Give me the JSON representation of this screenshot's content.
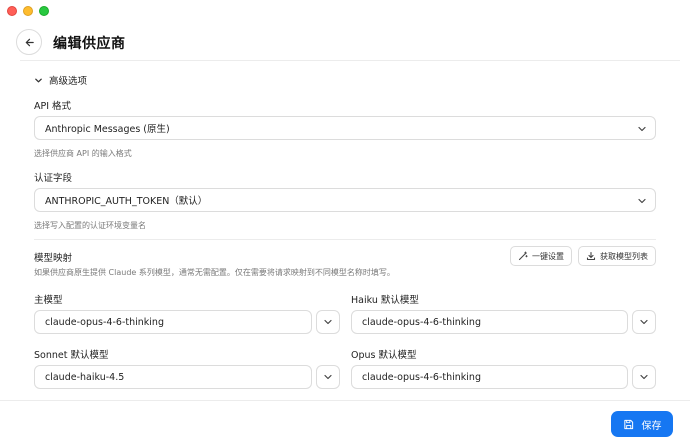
{
  "header": {
    "title": "编辑供应商"
  },
  "advanced": {
    "toggle_label": "高级选项",
    "api_format": {
      "label": "API 格式",
      "value": "Anthropic Messages (原生)",
      "hint": "选择供应商 API 的输入格式"
    },
    "auth_field": {
      "label": "认证字段",
      "value": "ANTHROPIC_AUTH_TOKEN（默认）",
      "hint": "选择写入配置的认证环境变量名"
    }
  },
  "model_mapping": {
    "title": "模型映射",
    "description": "如果供应商原生提供 Claude 系列模型，通常无需配置。仅在需要将请求映射到不同模型名称时填写。",
    "one_click_label": "一键设置",
    "fetch_list_label": "获取模型列表",
    "main_model": {
      "label": "主模型",
      "value": "claude-opus-4-6-thinking"
    },
    "haiku_model": {
      "label": "Haiku 默认模型",
      "value": "claude-opus-4-6-thinking"
    },
    "sonnet_model": {
      "label": "Sonnet 默认模型",
      "value": "claude-haiku-4.5"
    },
    "opus_model": {
      "label": "Opus 默认模型",
      "value": "claude-opus-4-6-thinking"
    }
  },
  "footer": {
    "save_label": "保存"
  },
  "colors": {
    "accent": "#1677f2",
    "traffic_red": "#ff5f57",
    "traffic_yellow": "#febc2e",
    "traffic_green": "#28c840"
  }
}
